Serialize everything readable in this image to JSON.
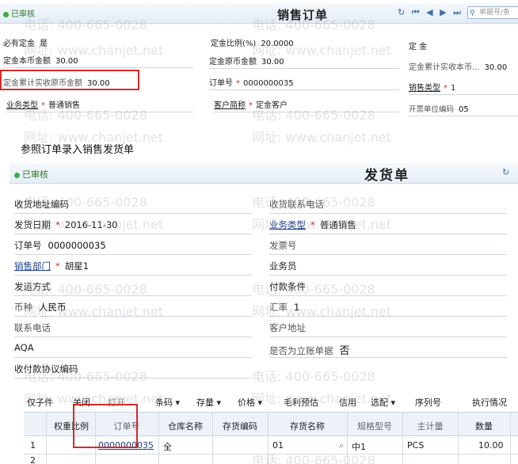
{
  "sales_order": {
    "status": "已审核",
    "title": "销售订单",
    "nav_icons": [
      "refresh-icon",
      "first-icon",
      "prev-icon",
      "next-icon",
      "last-icon"
    ],
    "nav_glyphs": [
      "↻",
      "⏮",
      "◀",
      "▶",
      "⏭"
    ],
    "search_placeholder": "单据号/条",
    "fields": {
      "must_deposit_label": "必有定金",
      "must_deposit_value": "是",
      "deposit_ratio_label": "定金比例(%)",
      "deposit_ratio_value": "20.0000",
      "deposit_label": "定 金",
      "deposit_local_label": "定金本币金额",
      "deposit_local_value": "30.00",
      "deposit_orig_label": "定金原币金额",
      "deposit_orig_value": "30.00",
      "deposit_cum_local_label": "定金累计实收本币...",
      "deposit_cum_local_value": "30.00",
      "deposit_cum_orig_label": "定金累计实收原币金额",
      "deposit_cum_orig_value": "30.00",
      "order_no_label": "订单号",
      "order_no_value": "0000000035",
      "sales_type_label": "销售类型",
      "sales_type_value": "1",
      "business_type_label": "业务类型",
      "business_type_value": "普通销售",
      "customer_label": "客户简称",
      "customer_value": "定金客户",
      "invoice_unit_label": "开票单位编码",
      "invoice_unit_value": "05"
    }
  },
  "caption": "参照订单录入销售发货单",
  "delivery": {
    "status": "已审核",
    "title": "发货单",
    "refresh_icon": "refresh-icon",
    "left_fields": [
      {
        "label": "收货地址编码",
        "value": ""
      },
      {
        "label": "发货日期",
        "value": "2016-11-30",
        "required": true
      },
      {
        "label": "订单号",
        "value": "0000000035"
      },
      {
        "label": "销售部门",
        "value": "胡星1",
        "required": true
      },
      {
        "label": "发运方式",
        "value": ""
      },
      {
        "label": "币种",
        "value": "人民币"
      },
      {
        "label": "联系电话",
        "value": ""
      },
      {
        "label": "AQA",
        "value": ""
      },
      {
        "label": "收付款协议编码",
        "value": ""
      }
    ],
    "right_fields": [
      {
        "label": "收货联系电话",
        "value": ""
      },
      {
        "label": "业务类型",
        "value": "普通销售",
        "required": true
      },
      {
        "label": "发票号",
        "value": ""
      },
      {
        "label": "业务员",
        "value": ""
      },
      {
        "label": "付款条件",
        "value": ""
      },
      {
        "label": "汇率",
        "value": "1"
      },
      {
        "label": "客户地址",
        "value": ""
      },
      {
        "label": "是否为立账单据",
        "value": "否"
      }
    ],
    "toolbar": [
      {
        "label": "仅子件",
        "disabled": false
      },
      {
        "label": "关闭",
        "disabled": false
      },
      {
        "label": "打开",
        "disabled": true
      },
      {
        "label": "条码 ▾",
        "disabled": false
      },
      {
        "label": "存量 ▾",
        "disabled": false
      },
      {
        "label": "价格 ▾",
        "disabled": false
      },
      {
        "label": "毛利预估",
        "disabled": false
      },
      {
        "label": "信用",
        "disabled": false
      },
      {
        "label": "选配 ▾",
        "disabled": false
      },
      {
        "label": "序列号",
        "disabled": false
      },
      {
        "label": "执行情况",
        "disabled": false
      }
    ],
    "grid": {
      "columns": [
        "权重比例",
        "订单号",
        "仓库名称",
        "存货编码",
        "存货名称",
        "规格型号",
        "主计量",
        "数量"
      ],
      "rows": [
        {
          "num": "1",
          "order_no": "0000000035",
          "warehouse": "全",
          "inv_code": "",
          "inv_name": "01",
          "spec": "中1",
          "unit": "PCS",
          "qty": "10.00"
        },
        {
          "num": "2",
          "order_no": "",
          "warehouse": "",
          "inv_code": "",
          "inv_name": "",
          "spec": "",
          "unit": "",
          "qty": ""
        }
      ]
    }
  },
  "watermark": {
    "phone": "电话: 400-665-0028",
    "site": "网址: www.chanjet.net"
  }
}
